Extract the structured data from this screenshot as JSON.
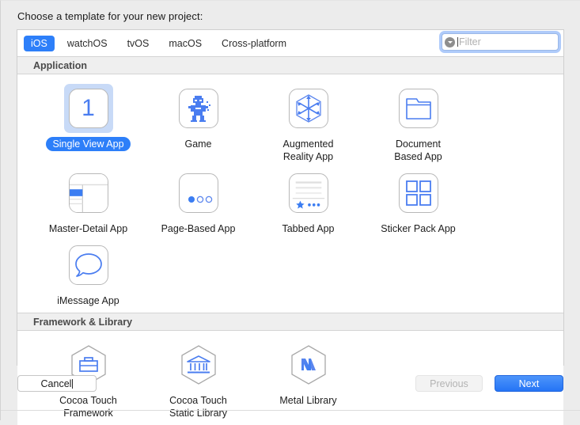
{
  "dialog": {
    "prompt": "Choose a template for your new project:"
  },
  "platform_tabs": [
    {
      "label": "iOS",
      "active": true
    },
    {
      "label": "watchOS",
      "active": false
    },
    {
      "label": "tvOS",
      "active": false
    },
    {
      "label": "macOS",
      "active": false
    },
    {
      "label": "Cross-platform",
      "active": false
    }
  ],
  "filter": {
    "placeholder": "Filter",
    "value": "",
    "icon": "filter-dropdown-icon",
    "focused": true
  },
  "sections": [
    {
      "title": "Application",
      "items": [
        {
          "label": "Single View App",
          "icon": "single-view-icon",
          "selected": true
        },
        {
          "label": "Game",
          "icon": "game-robot-icon",
          "selected": false
        },
        {
          "label": "Augmented\nReality App",
          "icon": "augmented-reality-icon",
          "selected": false
        },
        {
          "label": "Document\nBased App",
          "icon": "document-folder-icon",
          "selected": false
        },
        {
          "label": "Master-Detail App",
          "icon": "master-detail-icon",
          "selected": false
        },
        {
          "label": "Page-Based App",
          "icon": "page-based-icon",
          "selected": false
        },
        {
          "label": "Tabbed App",
          "icon": "tabbed-app-icon",
          "selected": false
        },
        {
          "label": "Sticker Pack App",
          "icon": "sticker-pack-icon",
          "selected": false
        },
        {
          "label": "iMessage App",
          "icon": "imessage-bubble-icon",
          "selected": false
        }
      ]
    },
    {
      "title": "Framework & Library",
      "items": [
        {
          "label": "Cocoa Touch\nFramework",
          "icon": "toolbox-hex-icon",
          "selected": false
        },
        {
          "label": "Cocoa Touch\nStatic Library",
          "icon": "bank-hex-icon",
          "selected": false
        },
        {
          "label": "Metal Library",
          "icon": "metal-hex-icon",
          "selected": false
        }
      ]
    }
  ],
  "footer": {
    "cancel": "Cancel",
    "previous": "Previous",
    "next": "Next",
    "previous_disabled": true
  },
  "colors": {
    "accent": "#2d7ff9",
    "selection_bg": "#c8daf7",
    "icon_blue": "#4a7df0",
    "panel_bg": "#ffffff",
    "window_bg": "#ececec"
  }
}
